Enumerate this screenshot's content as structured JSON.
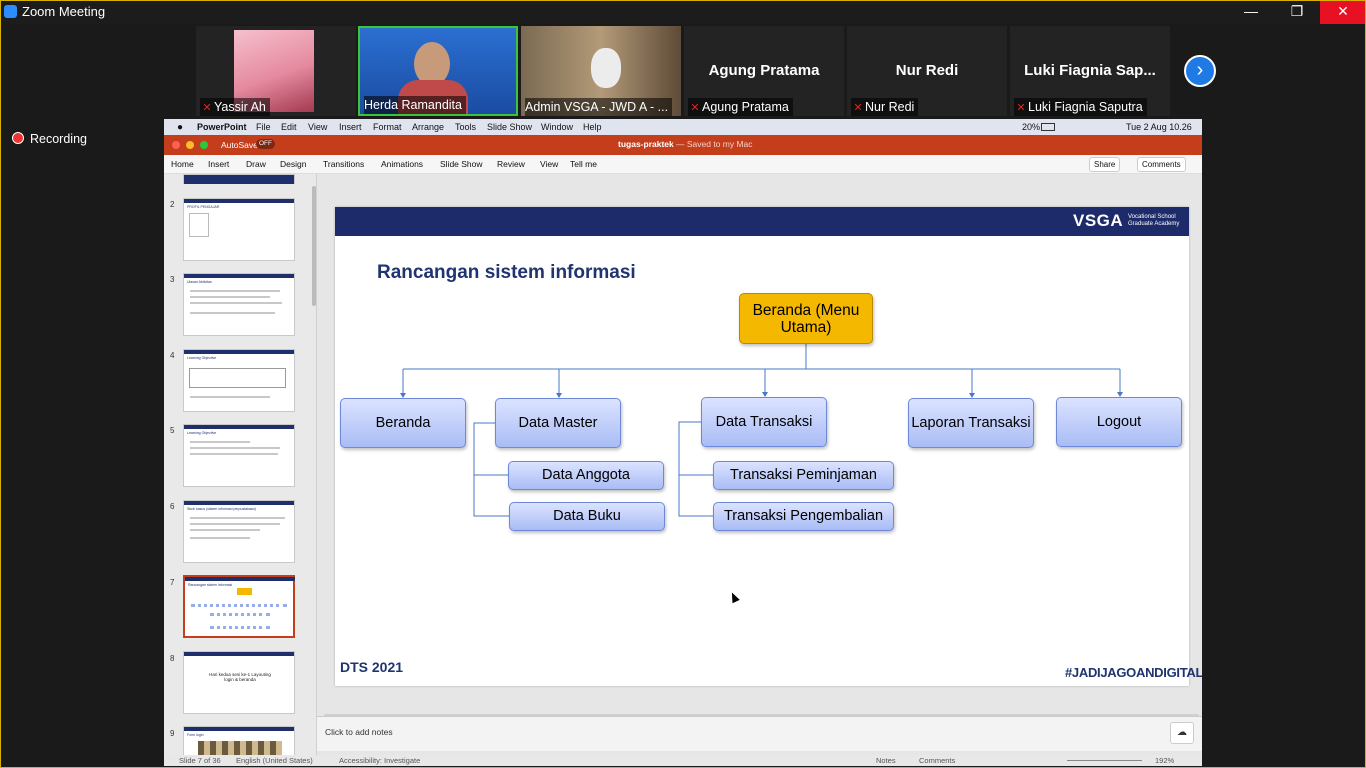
{
  "window": {
    "title": "Zoom Meeting",
    "minimize": "—",
    "restore": "❐",
    "close": "✕"
  },
  "participants": [
    {
      "name": "Yassir Ah",
      "big_name": ""
    },
    {
      "name": "Herda Ramandita",
      "big_name": ""
    },
    {
      "name": "Admin VSGA - JWD A - ...",
      "big_name": ""
    },
    {
      "name": "Agung Pratama",
      "big_name": "Agung Pratama"
    },
    {
      "name": "Nur Redi",
      "big_name": "Nur Redi"
    },
    {
      "name": "Luki Fiagnia Saputra",
      "big_name": "Luki Fiagnia Sap..."
    }
  ],
  "next_arrow": "›",
  "recording": "Recording",
  "mac_menu": {
    "app": "PowerPoint",
    "items": [
      "File",
      "Edit",
      "View",
      "Insert",
      "Format",
      "Arrange",
      "Tools",
      "Slide Show",
      "Window",
      "Help"
    ],
    "battery": "20%",
    "clock": "Tue 2 Aug  10.26"
  },
  "ppt": {
    "autosave": "AutoSave",
    "autosave_state": "OFF",
    "doc_title": "tugas-praktek",
    "doc_status": "— Saved to my Mac",
    "tabs": [
      "Home",
      "Insert",
      "Draw",
      "Design",
      "Transitions",
      "Animations",
      "Slide Show",
      "Review",
      "View",
      "Tell me"
    ],
    "share": "Share",
    "comments": "Comments",
    "notes_placeholder": "Click to add notes",
    "status_slide": "Slide 7 of 36",
    "status_lang": "English (United States)",
    "status_access": "Accessibility: Investigate",
    "status_notes": "Notes",
    "status_comments": "Comments",
    "zoom": "192%"
  },
  "thumbnails": [
    {
      "num": "2",
      "title": "PROFIL PENGAJAR"
    },
    {
      "num": "3",
      "title": "Ulasan Aktivitas"
    },
    {
      "num": "4",
      "title": "Learning Objective"
    },
    {
      "num": "5",
      "title": "Learning Objective"
    },
    {
      "num": "6",
      "title": "Studi kasus (sistem informasi perpustakaan)"
    },
    {
      "num": "7",
      "title": "Rancangan sistem informasi"
    },
    {
      "num": "8",
      "title": "Hari kedua sesi ke-1 Layouting login & beranda"
    },
    {
      "num": "9",
      "title": "Form login"
    }
  ],
  "slide": {
    "logo": "VSGA",
    "logo_sub": "Vocational School Graduate Academy",
    "title": "Rancangan sistem informasi",
    "root": "Beranda (Menu Utama)",
    "menu": {
      "beranda": "Beranda",
      "data_master": "Data Master",
      "data_transaksi": "Data Transaksi",
      "laporan": "Laporan Transaksi",
      "logout": "Logout"
    },
    "sub": {
      "anggota": "Data Anggota",
      "buku": "Data Buku",
      "peminjaman": "Transaksi Peminjaman",
      "pengembalian": "Transaksi Pengembalian"
    },
    "footer_left": "DTS 2021",
    "footer_right": "#JADIJAGOANDIGITAL"
  },
  "colors": {
    "accent_orange": "#c43e1c",
    "slide_navy": "#1d2b6a",
    "root_box": "#f5b800",
    "tile_active": "#3bc43b"
  }
}
